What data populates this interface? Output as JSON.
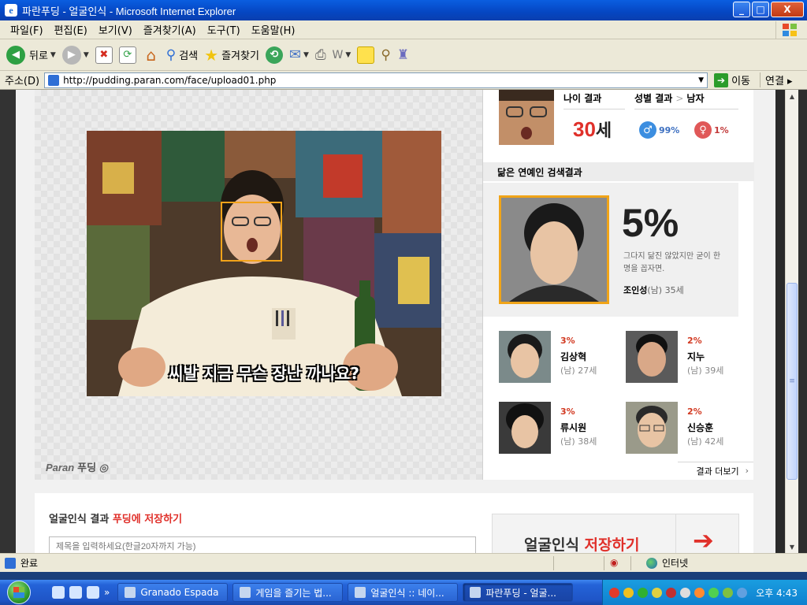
{
  "window": {
    "title": "파란푸딩 - 얼굴인식 - Microsoft Internet Explorer",
    "buttons": [
      "_",
      "□",
      "X"
    ]
  },
  "menu": [
    "파일(F)",
    "편집(E)",
    "보기(V)",
    "즐겨찾기(A)",
    "도구(T)",
    "도움말(H)"
  ],
  "toolbar": {
    "back": "뒤로",
    "search": "검색",
    "favorites": "즐겨찾기"
  },
  "address": {
    "label": "주소(D)",
    "url": "http://pudding.paran.com/face/upload01.php",
    "go": "이동",
    "links": "연결"
  },
  "photo": {
    "subtitle": "씨발 지금 무슨 장난 까나요?",
    "logo_brand": "Paran",
    "logo_service": "푸딩"
  },
  "result": {
    "age_header": "나이 결과",
    "gender_header": "성별 결과",
    "gender_sep": ">",
    "gender_value": "남자",
    "age_value": "30",
    "age_unit": "세",
    "male_pct": "99%",
    "female_pct": "1%"
  },
  "similar": {
    "header": "닮은 연예인 검색결과",
    "top": {
      "pct": "5%",
      "desc": "그다지 닮진 않았지만 굳이 한명을 꼽자면.",
      "name": "조인성",
      "meta": "(남) 35세"
    },
    "others": [
      {
        "pct": "3%",
        "name": "김상혁",
        "meta": "(남) 27세"
      },
      {
        "pct": "2%",
        "name": "지누",
        "meta": "(남) 39세"
      },
      {
        "pct": "3%",
        "name": "류시원",
        "meta": "(남) 38세"
      },
      {
        "pct": "2%",
        "name": "신승훈",
        "meta": "(남) 42세"
      }
    ],
    "more": "결과 더보기"
  },
  "save": {
    "title_a": "얼굴인식 결과 ",
    "title_b": "푸딩에 저장하기",
    "placeholder": "제목을 입력하세요(한글20자까지 가능)",
    "button_a": "얼굴인식 ",
    "button_b": "저장하기"
  },
  "status": {
    "text": "완료",
    "zone": "인터넷"
  },
  "taskbar": {
    "tasks": [
      "Granado Espada",
      "게임을 즐기는 법...",
      "얼굴인식 :: 네이...",
      "파란푸딩 - 얼굴..."
    ],
    "clock": "오후 4:43",
    "more": "»"
  },
  "colors": {
    "accent": "#e0302a",
    "frame": "#f0a418",
    "xp_blue": "#245edb"
  }
}
